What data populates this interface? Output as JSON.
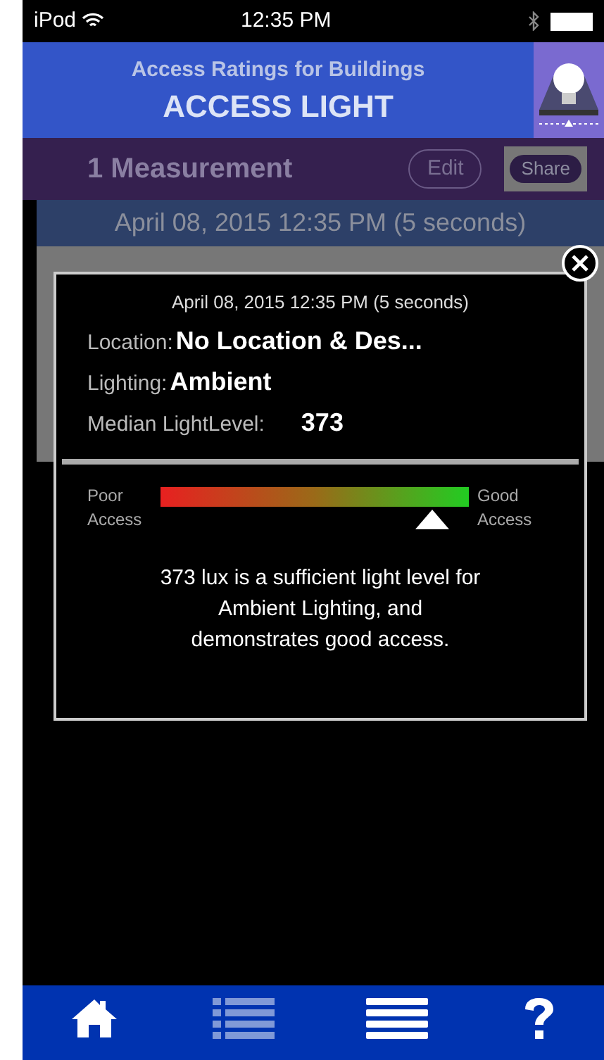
{
  "status_bar": {
    "carrier": "iPod",
    "time": "12:35 PM"
  },
  "header": {
    "subtitle": "Access Ratings for Buildings",
    "title": "ACCESS LIGHT"
  },
  "toolbar": {
    "count": "1 Measurement",
    "edit": "Edit",
    "share": "Share"
  },
  "list_header": "April 08, 2015  12:35 PM (5 seconds)",
  "popup": {
    "timestamp": "April 08, 2015  12:35 PM (5 seconds)",
    "fields": [
      {
        "label": "Location:",
        "value": "No Location & Des..."
      },
      {
        "label": "Lighting:",
        "value": "Ambient"
      },
      {
        "label": "Median LightLevel:",
        "value": "373"
      }
    ],
    "meter": {
      "low_line1": "Poor",
      "low_line2": "Access",
      "high_line1": "Good",
      "high_line2": "Access",
      "level": 0.88
    },
    "message": "373 lux is a sufficient light level for Ambient Lighting, and demonstrates good access."
  },
  "tabs": [
    {
      "kind": "home",
      "selected": false
    },
    {
      "kind": "list",
      "selected": true
    },
    {
      "kind": "about",
      "selected": false
    },
    {
      "kind": "help",
      "selected": false
    }
  ]
}
